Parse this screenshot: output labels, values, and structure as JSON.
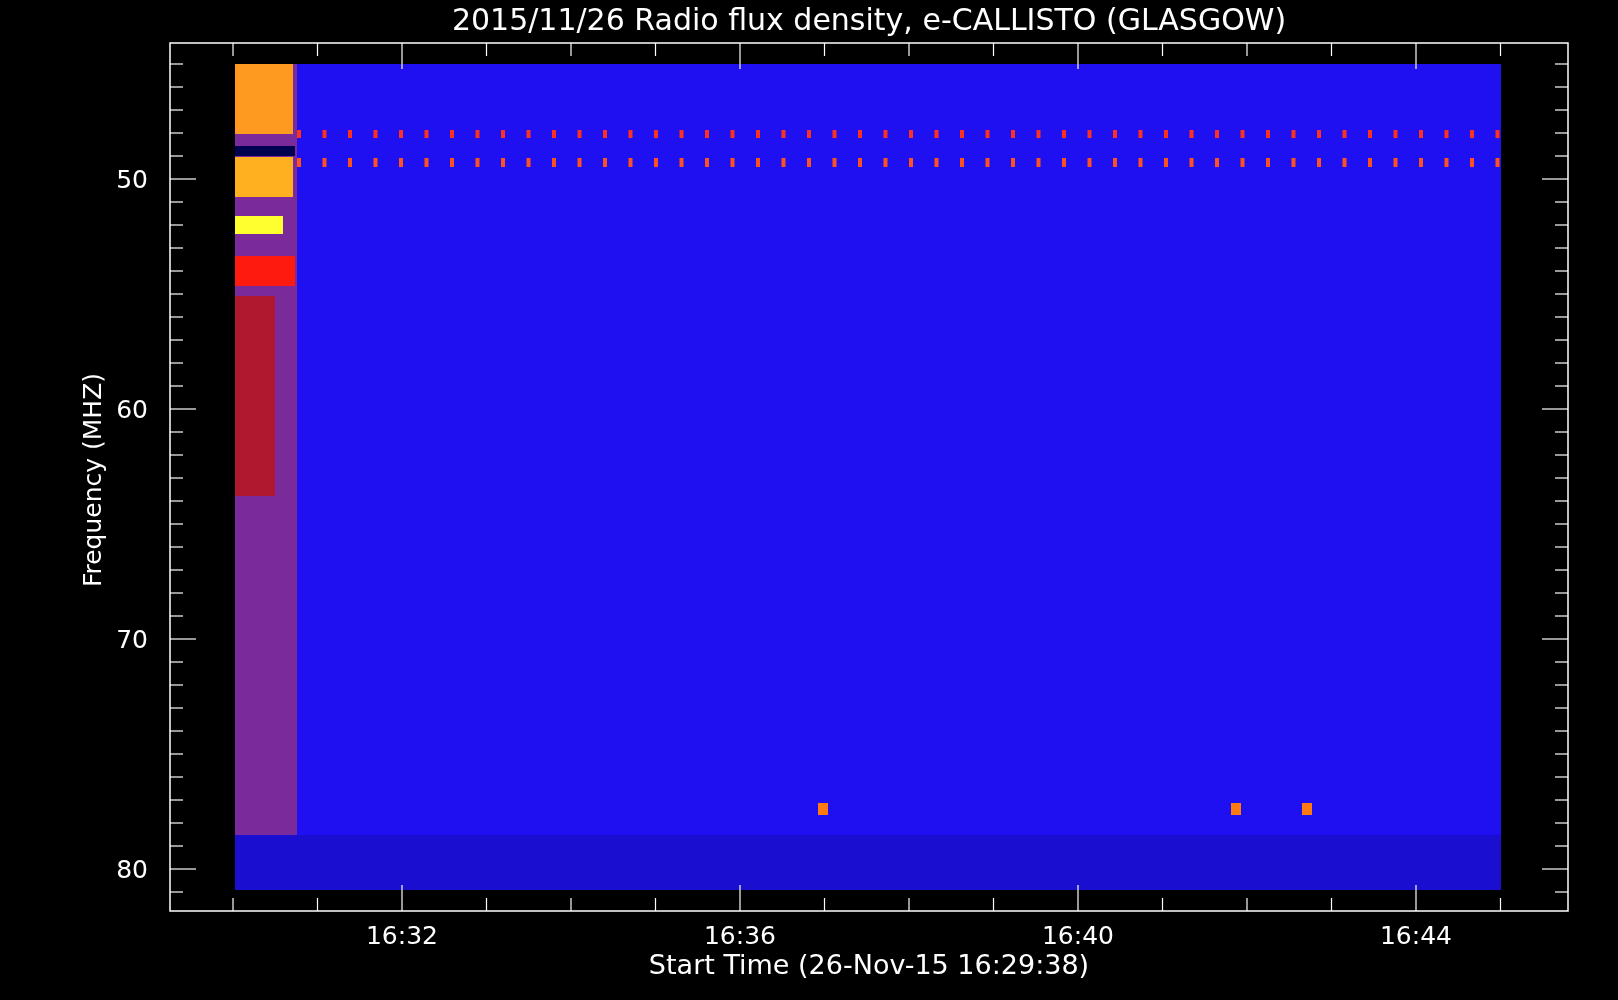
{
  "title": "2015/11/26  Radio flux density, e-CALLISTO (GLASGOW)",
  "y_axis": {
    "label": "Frequency (MHZ)",
    "ticks": [
      "50",
      "60",
      "70",
      "80"
    ]
  },
  "x_axis": {
    "label": "Start Time (26-Nov-15 16:29:38)",
    "ticks": [
      "16:32",
      "16:36",
      "16:40",
      "16:44"
    ]
  }
}
